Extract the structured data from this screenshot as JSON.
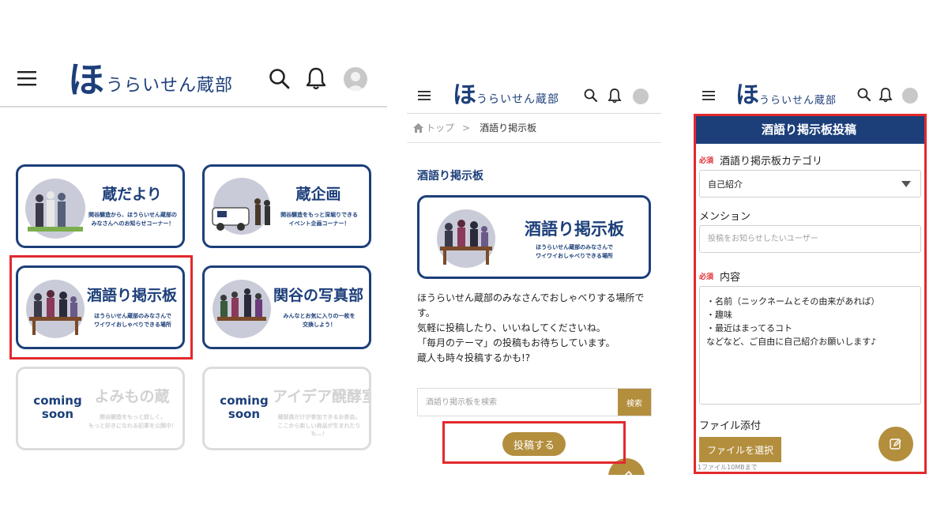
{
  "brand": {
    "logo_mark": "ほ",
    "logo_text": "うらいせん蔵部"
  },
  "colors": {
    "navy": "#1c3f7a",
    "gold": "#b38e3d",
    "highlight": "#e2292d"
  },
  "icons": {
    "menu": "hamburger-menu-icon",
    "search": "search-icon",
    "bell": "bell-icon",
    "avatar": "user-avatar-icon",
    "home": "home-icon",
    "edit": "edit-pencil-icon",
    "dropdown": "caret-down-icon"
  },
  "panel1": {
    "cards": [
      {
        "title": "蔵だより",
        "desc": "関谷醸造から、ほうらいせん蔵部の\nみなさんへのお知らせコーナー！"
      },
      {
        "title": "蔵企画",
        "desc": "関谷醸造をもっと深堀りできる\nイベント企画コーナー！"
      },
      {
        "title": "酒語り掲示板",
        "desc": "ほうらいせん蔵部のみなさんで\nワイワイおしゃべりできる場所"
      },
      {
        "title": "関谷の写真部",
        "desc": "みんなとお気に入りの一枚を\n交換しよう！"
      },
      {
        "title": "よみもの蔵",
        "desc": "関谷醸造をもっと詳しく、\nもっと好きになれる記事を公開中！",
        "soon": "coming\nsoon"
      },
      {
        "title": "アイデア醗酵室",
        "desc": "蔵部員だけが参加できるお茶会。\nここから新しい商品が生まれたりも…！",
        "soon": "coming\nsoon"
      }
    ]
  },
  "panel2": {
    "breadcrumb": {
      "home": "トップ",
      "sep": ">",
      "current": "酒語り掲示板"
    },
    "page_title": "酒語り掲示板",
    "banner": {
      "title": "酒語り掲示板",
      "desc": "ほうらいせん蔵部のみなさんで\nワイワイおしゃべりできる場所"
    },
    "description": [
      "ほうらいせん蔵部のみなさんでおしゃべりする場所で",
      "す。",
      "気軽に投稿したり、いいねしてくださいね。",
      "「毎月のテーマ」の投稿もお待ちしています。",
      "蔵人も時々投稿するかも!?"
    ],
    "search": {
      "placeholder": "酒語り掲示板を検索",
      "button": "検索"
    },
    "post_button": "投稿する"
  },
  "panel3": {
    "form_title": "酒語り掲示板投稿",
    "required": "必須",
    "category": {
      "label": "酒語り掲示板カテゴリ",
      "value": "自己紹介"
    },
    "mention": {
      "label": "メンション",
      "placeholder": "投稿をお知らせしたいユーザー"
    },
    "content": {
      "label": "内容",
      "lines": [
        "・名前（ニックネームとその由来があれば）",
        "・趣味",
        "・最近はまってるコト",
        "などなど、ご自由に自己紹介お願いします♪"
      ]
    },
    "file": {
      "label": "ファイル添付",
      "button": "ファイルを選択",
      "note": "1ファイル10MBまで"
    }
  }
}
